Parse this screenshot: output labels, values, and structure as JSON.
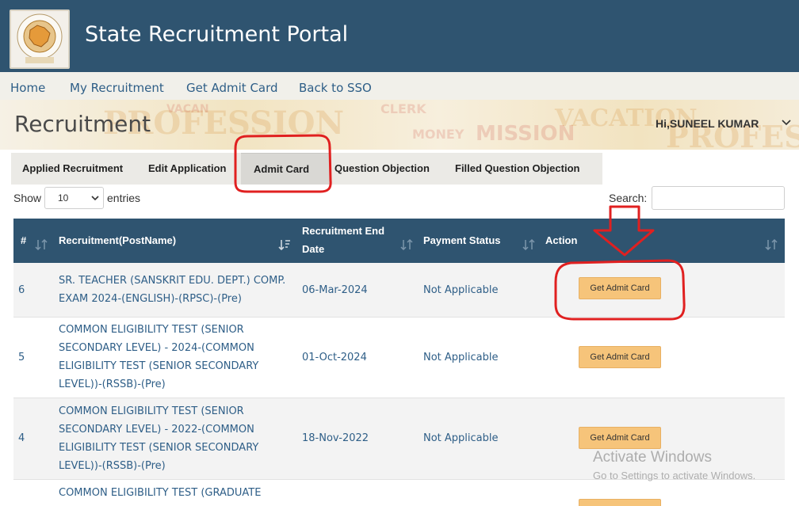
{
  "header": {
    "title": "State Recruitment Portal",
    "logo_text": "Rajasthan"
  },
  "nav": {
    "items": [
      "Home",
      "My Recruitment",
      "Get Admit Card",
      "Back to SSO"
    ]
  },
  "banner": {
    "heading": "Recruitment",
    "greeting": "Hi,SUNEEL KUMAR"
  },
  "tabs": {
    "items": [
      "Applied Recruitment",
      "Edit Application",
      "Admit Card",
      "Question Objection",
      "Filled Question Objection"
    ],
    "active": "Admit Card"
  },
  "controls": {
    "show_label": "Show",
    "page_size": "10",
    "entries_label": "entries",
    "search_label": "Search:",
    "search_value": ""
  },
  "table": {
    "columns": [
      "#",
      "Recruitment(PostName)",
      "Recruitment End Date",
      "Payment Status",
      "Action"
    ],
    "rows": [
      {
        "num": "6",
        "post": "SR. TEACHER (SANSKRIT EDU. DEPT.) COMP. EXAM 2024-(ENGLISH)-(RPSC)-(Pre)",
        "end_date": "06-Mar-2024",
        "payment": "Not Applicable",
        "action": "Get Admit Card"
      },
      {
        "num": "5",
        "post": "COMMON ELIGIBILITY TEST (SENIOR SECONDARY LEVEL) - 2024-(COMMON ELIGIBILITY TEST (SENIOR SECONDARY LEVEL))-(RSSB)-(Pre)",
        "end_date": "01-Oct-2024",
        "payment": "Not Applicable",
        "action": "Get Admit Card"
      },
      {
        "num": "4",
        "post": "COMMON ELIGIBILITY TEST (SENIOR SECONDARY LEVEL) - 2022-(COMMON ELIGIBILITY TEST (SENIOR SECONDARY LEVEL))-(RSSB)-(Pre)",
        "end_date": "18-Nov-2022",
        "payment": "Not Applicable",
        "action": "Get Admit Card"
      },
      {
        "num": "",
        "post": "COMMON ELIGIBILITY TEST (GRADUATE",
        "end_date": "",
        "payment": "",
        "action": ""
      }
    ]
  },
  "watermark": {
    "line1": "Activate Windows",
    "line2": "Go to Settings to activate Windows."
  },
  "colors": {
    "header_bg": "#2f5470",
    "link": "#2e5e87",
    "button_bg": "#f6c47a",
    "annotation": "#e02020"
  },
  "icons": {
    "sort": "sort-icon",
    "dropdown": "chevron-down-icon"
  }
}
